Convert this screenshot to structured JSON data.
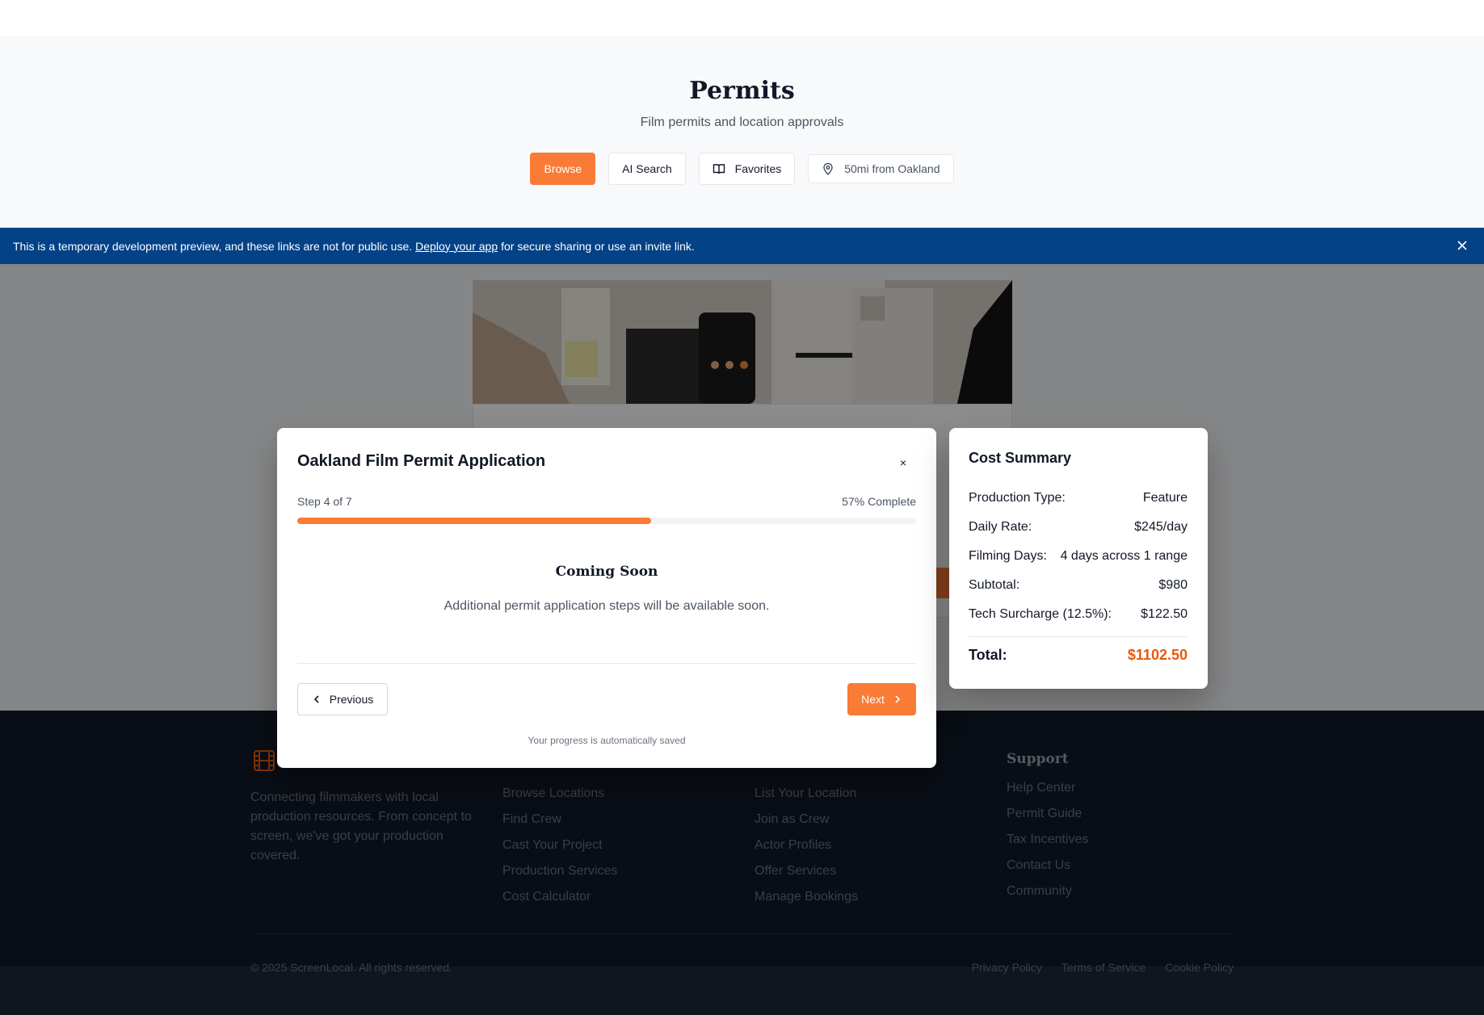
{
  "hero": {
    "title": "Permits",
    "subtitle": "Film permits and location approvals",
    "actions": {
      "browse": "Browse",
      "ai_search": "AI Search",
      "favorites": "Favorites",
      "location": "50mi from Oakland"
    }
  },
  "banner": {
    "text_before": "This is a temporary development preview, and these links are not for public use.",
    "link": "Deploy your app",
    "text_after": "for secure sharing or use an invite link."
  },
  "modal": {
    "title": "Oakland Film Permit Application",
    "close": "×",
    "step": "Step 4 of 7",
    "percent": "57% Complete",
    "progress": 0.5714,
    "coming_title": "Coming Soon",
    "coming_text": "Additional permit application steps will be available soon.",
    "prev": "Previous",
    "next": "Next",
    "saved": "Your progress is automatically saved"
  },
  "cost": {
    "title": "Cost Summary",
    "rows": [
      {
        "label": "Production Type:",
        "value": "Feature"
      },
      {
        "label": "Daily Rate:",
        "value": "$245/day"
      },
      {
        "label": "Filming Days:",
        "value": "4 days across 1 range"
      },
      {
        "label": "Subtotal:",
        "value": "$980"
      },
      {
        "label": "Tech Surcharge (12.5%):",
        "value": "$122.50"
      }
    ],
    "total_label": "Total:",
    "total_value": "$1102.50"
  },
  "footer": {
    "about": "Connecting filmmakers with local production resources. From concept to screen, we've got your production covered.",
    "col1": [
      "Browse Locations",
      "Find Crew",
      "Cast Your Project",
      "Production Services",
      "Cost Calculator"
    ],
    "col2": [
      "List Your Location",
      "Join as Crew",
      "Actor Profiles",
      "Offer Services",
      "Manage Bookings"
    ],
    "col3_title": "Support",
    "col3": [
      "Help Center",
      "Permit Guide",
      "Tax Incentives",
      "Contact Us",
      "Community"
    ],
    "copyright": "© 2025 ScreenLocal. All rights reserved.",
    "legal": [
      "Privacy Policy",
      "Terms of Service",
      "Cookie Policy"
    ]
  },
  "colors": {
    "accent": "#f97b35",
    "banner": "#034287",
    "footer": "#111827",
    "total": "#ea580c"
  }
}
